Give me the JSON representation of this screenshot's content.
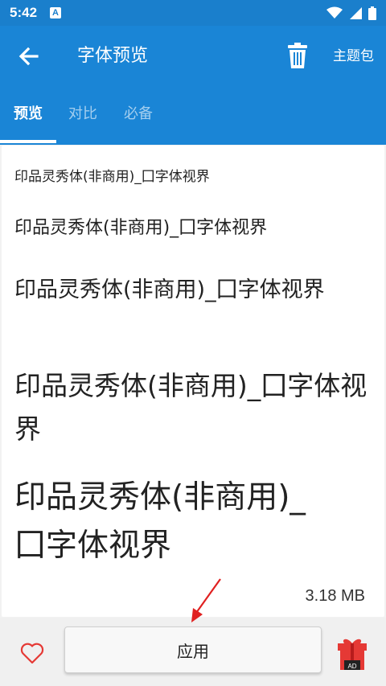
{
  "status_bar": {
    "time": "5:42",
    "notification_icon": "A"
  },
  "app_bar": {
    "title": "字体预览",
    "theme_pack_label": "主题包"
  },
  "tabs": [
    {
      "label": "预览",
      "active": true
    },
    {
      "label": "对比",
      "active": false
    },
    {
      "label": "必备",
      "active": false
    }
  ],
  "preview": {
    "samples": [
      "印品灵秀体(非商用)_囗字体视界",
      "印品灵秀体(非商用)_囗字体视界",
      "印品灵秀体(非商用)_囗字体视界",
      "印品灵秀体(非商用)_囗字体视界",
      "印品灵秀体(非商用)_囗字体视界"
    ],
    "file_size": "3.18 MB"
  },
  "bottom_bar": {
    "apply_label": "应用",
    "gift_badge": "AD"
  },
  "colors": {
    "primary": "#1a85d6",
    "status_bar": "#1a7fcc",
    "heart": "#e53935",
    "gift": "#e53935"
  }
}
